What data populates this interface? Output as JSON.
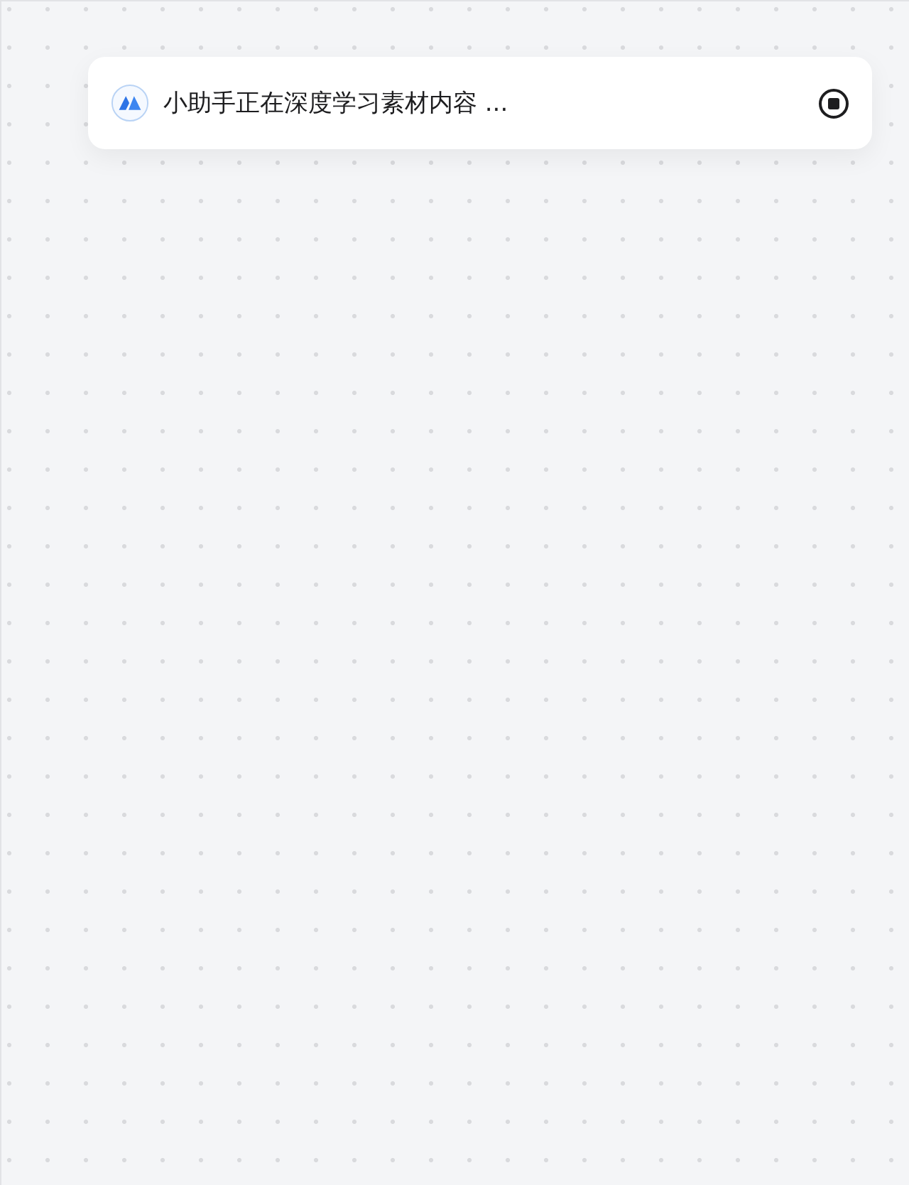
{
  "status_bar": {
    "message": "小助手正在深度学习素材内容 ..."
  }
}
